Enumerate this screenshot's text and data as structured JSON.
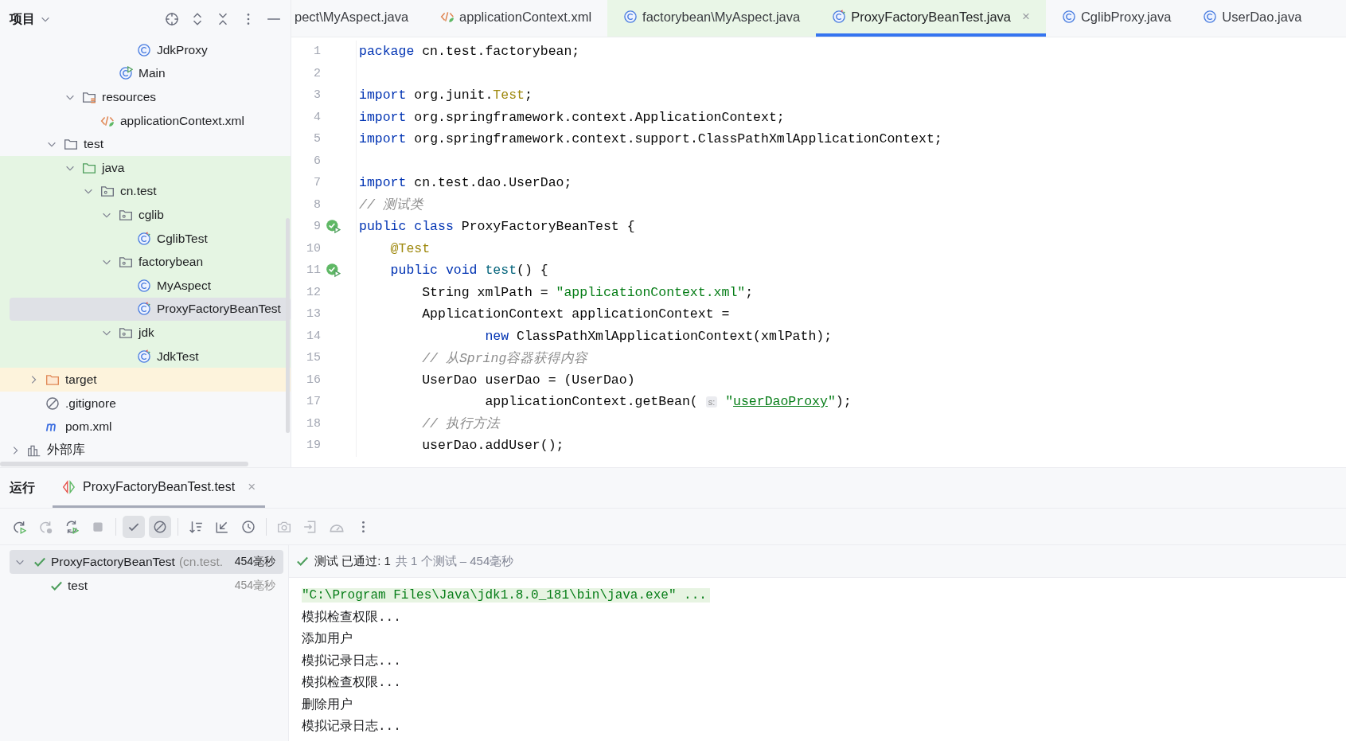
{
  "project_panel": {
    "title": "项目",
    "tree": [
      {
        "children": [
          {
            "children": [
              {
                "children": [
                  {
                    "children": [
                      {
                        "children": [
                          {
                            "children": [
                              {
                                "label": "JdkProxy",
                                "kind": "class",
                                "selected": false
                              }
                            ]
                          },
                          {
                            "label": "Main",
                            "kind": "main-class",
                            "selected": false
                          }
                        ]
                      }
                    ]
                  },
                  {
                    "label": "resources",
                    "kind": "resources-folder",
                    "expanded": true,
                    "selected": false,
                    "children": [
                      {
                        "label": "applicationContext.xml",
                        "kind": "xml",
                        "selected": false
                      }
                    ]
                  }
                ]
              },
              {
                "label": "test",
                "kind": "folder",
                "expanded": true,
                "selected": false,
                "children": [
                  {
                    "label": "java",
                    "kind": "test-root",
                    "test_source": true,
                    "expanded": true,
                    "selected": false,
                    "children": [
                      {
                        "label": "cn.test",
                        "kind": "package",
                        "expanded": true,
                        "selected": false,
                        "children": [
                          {
                            "label": "cglib",
                            "kind": "package",
                            "expanded": true,
                            "selected": false,
                            "children": [
                              {
                                "label": "CglibTest",
                                "kind": "test-class",
                                "selected": false
                              }
                            ]
                          },
                          {
                            "label": "factorybean",
                            "kind": "package",
                            "expanded": true,
                            "selected": false,
                            "children": [
                              {
                                "label": "MyAspect",
                                "kind": "class",
                                "selected": false
                              },
                              {
                                "label": "ProxyFactoryBeanTest",
                                "kind": "test-class",
                                "selected": true
                              }
                            ]
                          },
                          {
                            "label": "jdk",
                            "kind": "package",
                            "expanded": true,
                            "selected": false,
                            "children": [
                              {
                                "label": "JdkTest",
                                "kind": "test-class",
                                "selected": false
                              }
                            ]
                          }
                        ]
                      }
                    ]
                  }
                ]
              }
            ]
          },
          {
            "label": "target",
            "kind": "excluded-folder",
            "expanded": false,
            "selected": false
          },
          {
            "label": ".gitignore",
            "kind": "ignore",
            "selected": false
          },
          {
            "label": "pom.xml",
            "kind": "maven",
            "selected": false
          }
        ]
      },
      {
        "label": "外部库",
        "kind": "library",
        "expanded": false,
        "selected": false
      }
    ]
  },
  "editor": {
    "tabs": [
      {
        "label": "pect\\MyAspect.java",
        "selected": false
      },
      {
        "label": "applicationContext.xml",
        "kind": "xml",
        "selected": false
      },
      {
        "label": "factorybean\\MyAspect.java",
        "kind": "class",
        "test_source": true,
        "selected": false
      },
      {
        "label": "ProxyFactoryBeanTest.java",
        "kind": "test-class",
        "test_source": true,
        "selected": true,
        "close": "×"
      },
      {
        "label": "CglibProxy.java",
        "kind": "class",
        "selected": false
      },
      {
        "label": "UserDao.java",
        "kind": "class",
        "selected": false
      }
    ],
    "lines": [
      {
        "number": "1",
        "run": false,
        "tokens": [
          {
            "kind": "kw",
            "text": "package"
          },
          {
            "kind": "plain",
            "text": " cn.test.factorybean;"
          }
        ]
      },
      {
        "number": "2",
        "run": false
      },
      {
        "number": "3",
        "run": false,
        "tokens": [
          {
            "kind": "kw",
            "text": "import"
          },
          {
            "kind": "plain",
            "text": " org.junit."
          },
          {
            "kind": "ann",
            "text": "Test"
          },
          {
            "kind": "plain",
            "text": ";"
          }
        ]
      },
      {
        "number": "4",
        "run": false,
        "tokens": [
          {
            "kind": "kw",
            "text": "import"
          },
          {
            "kind": "plain",
            "text": " org.springframework.context.ApplicationContext;"
          }
        ]
      },
      {
        "number": "5",
        "run": false,
        "tokens": [
          {
            "kind": "kw",
            "text": "import"
          },
          {
            "kind": "plain",
            "text": " org.springframework.context.support.ClassPathXmlApplicationContext;"
          }
        ]
      },
      {
        "number": "6",
        "run": false
      },
      {
        "number": "7",
        "run": false,
        "tokens": [
          {
            "kind": "kw",
            "text": "import"
          },
          {
            "kind": "plain",
            "text": " cn.test.dao.UserDao;"
          }
        ]
      },
      {
        "number": "8",
        "run": false,
        "tokens": [
          {
            "kind": "comment",
            "text": "// 测试类"
          }
        ]
      },
      {
        "number": "9",
        "run": true,
        "tokens": [
          {
            "kind": "kw",
            "text": "public class"
          },
          {
            "kind": "plain",
            "text": " ProxyFactoryBeanTest {"
          }
        ]
      },
      {
        "number": "10",
        "run": false,
        "tokens": [
          {
            "kind": "ann",
            "text": "    @Test"
          }
        ]
      },
      {
        "number": "11",
        "run": true,
        "tokens": [
          {
            "kind": "kw",
            "text": "    public void"
          },
          {
            "kind": "method",
            "text": " test"
          },
          {
            "kind": "plain",
            "text": "() {"
          }
        ]
      },
      {
        "number": "12",
        "run": false,
        "tokens": [
          {
            "kind": "plain",
            "text": "        String xmlPath = "
          },
          {
            "kind": "str",
            "text": "\"applicationContext.xml\""
          },
          {
            "kind": "plain",
            "text": ";"
          }
        ]
      },
      {
        "number": "13",
        "run": false,
        "tokens": [
          {
            "kind": "plain",
            "text": "        ApplicationContext applicationContext ="
          }
        ]
      },
      {
        "number": "14",
        "run": false,
        "tokens": [
          {
            "kind": "kw",
            "text": "                new"
          },
          {
            "kind": "plain",
            "text": " ClassPathXmlApplicationContext(xmlPath);"
          }
        ]
      },
      {
        "number": "15",
        "run": false,
        "tokens": [
          {
            "kind": "comment",
            "text": "        // 从Spring容器获得内容"
          }
        ]
      },
      {
        "number": "16",
        "run": false,
        "tokens": [
          {
            "kind": "plain",
            "text": "        UserDao userDao = (UserDao)"
          }
        ]
      },
      {
        "number": "17",
        "run": false,
        "tokens": [
          {
            "kind": "plain",
            "text": "                applicationContext.getBean( "
          },
          {
            "kind": "hint",
            "text": "s:"
          },
          {
            "kind": "str",
            "text": " \""
          },
          {
            "kind": "link",
            "text": "userDaoProxy"
          },
          {
            "kind": "str",
            "text": "\""
          },
          {
            "kind": "plain",
            "text": ");"
          }
        ]
      },
      {
        "number": "18",
        "run": false,
        "tokens": [
          {
            "kind": "comment",
            "text": "        // 执行方法"
          }
        ]
      },
      {
        "number": "19",
        "run": false,
        "tokens": [
          {
            "kind": "plain",
            "text": "        userDao.addUser();"
          }
        ]
      }
    ]
  },
  "run_panel": {
    "title": "运行",
    "tab": {
      "label": "ProxyFactoryBeanTest.test",
      "close": "×",
      "selected": true
    },
    "toolbar": [
      {
        "kind": "rerun",
        "disabled": false,
        "toggled": false
      },
      {
        "kind": "rerun-failed",
        "disabled": true,
        "toggled": false
      },
      {
        "kind": "auto-rerun",
        "disabled": false,
        "toggled": false
      },
      {
        "kind": "stop",
        "disabled": true,
        "toggled": false
      },
      {
        "kind": "show-passed",
        "disabled": false,
        "toggled": true
      },
      {
        "kind": "show-ignored",
        "disabled": false,
        "toggled": true
      },
      {
        "kind": "sort",
        "disabled": false,
        "toggled": false
      },
      {
        "kind": "import",
        "disabled": false,
        "toggled": false
      },
      {
        "kind": "history",
        "disabled": false,
        "toggled": false
      },
      {
        "kind": "camera",
        "disabled": true,
        "toggled": false
      },
      {
        "kind": "export",
        "disabled": true,
        "toggled": false
      },
      {
        "kind": "gauge",
        "disabled": true,
        "toggled": false
      },
      {
        "kind": "more",
        "disabled": false,
        "toggled": false
      }
    ],
    "tests": [
      {
        "label": "ProxyFactoryBeanTest",
        "detail": "(cn.test.",
        "time": "454毫秒",
        "passed": true,
        "expanded": true,
        "selected": true,
        "children": [
          {
            "label": "test",
            "time": "454毫秒",
            "passed": true,
            "selected": false
          }
        ]
      }
    ],
    "status": {
      "passed": true,
      "text": "测试 已通过: 1",
      "detail": "共 1 个测试 – 454毫秒"
    },
    "console": [
      {
        "kind": "command",
        "text": "\"C:\\Program Files\\Java\\jdk1.8.0_181\\bin\\java.exe\" ..."
      },
      {
        "kind": "output",
        "text": "模拟检查权限..."
      },
      {
        "kind": "output",
        "text": "添加用户"
      },
      {
        "kind": "output",
        "text": "模拟记录日志..."
      },
      {
        "kind": "output",
        "text": "模拟检查权限..."
      },
      {
        "kind": "output",
        "text": "删除用户"
      },
      {
        "kind": "output",
        "text": "模拟记录日志..."
      }
    ]
  }
}
